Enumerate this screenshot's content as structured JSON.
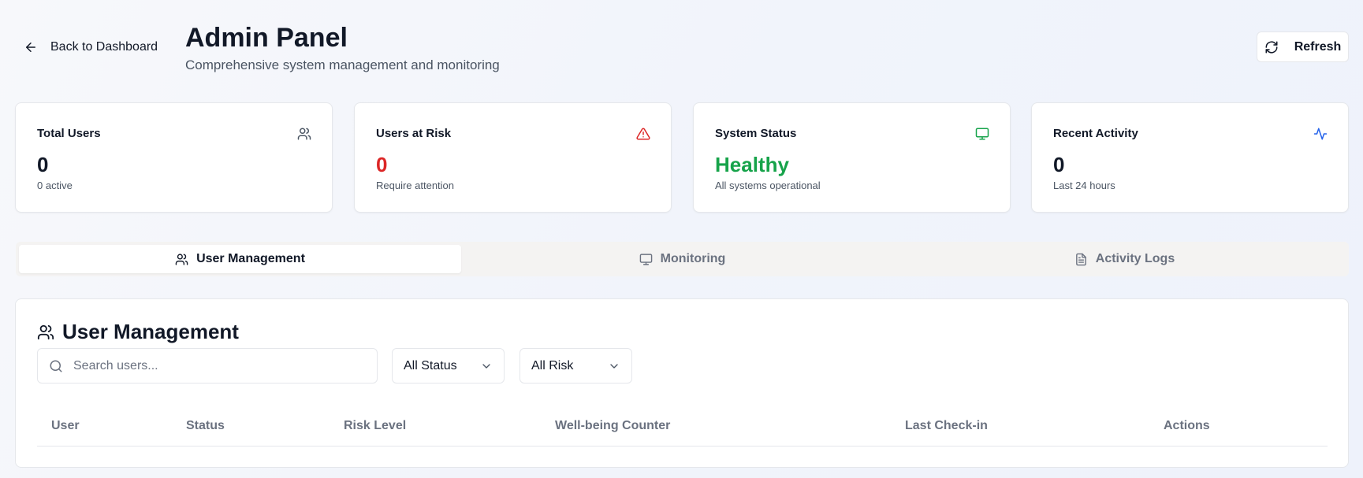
{
  "header": {
    "back_label": "Back to Dashboard",
    "title": "Admin Panel",
    "subtitle": "Comprehensive system management and monitoring",
    "refresh_label": "Refresh"
  },
  "stats": [
    {
      "label": "Total Users",
      "value": "0",
      "sub": "0 active",
      "icon": "users-icon",
      "value_color": "#111827",
      "icon_color": "#4b5563"
    },
    {
      "label": "Users at Risk",
      "value": "0",
      "sub": "Require attention",
      "icon": "alert-triangle-icon",
      "value_color": "#dc2626",
      "icon_color": "#dc2626"
    },
    {
      "label": "System Status",
      "value": "Healthy",
      "sub": "All systems operational",
      "icon": "monitor-icon",
      "value_color": "#16a34a",
      "icon_color": "#16a34a"
    },
    {
      "label": "Recent Activity",
      "value": "0",
      "sub": "Last 24 hours",
      "icon": "activity-icon",
      "value_color": "#111827",
      "icon_color": "#2563eb"
    }
  ],
  "tabs": [
    {
      "label": "User Management",
      "icon": "users-icon",
      "active": true
    },
    {
      "label": "Monitoring",
      "icon": "monitor-icon",
      "active": false
    },
    {
      "label": "Activity Logs",
      "icon": "file-text-icon",
      "active": false
    }
  ],
  "panel": {
    "title": "User Management",
    "search_placeholder": "Search users...",
    "status_filter": "All Status",
    "risk_filter": "All Risk",
    "columns": [
      "User",
      "Status",
      "Risk Level",
      "Well-being Counter",
      "Last Check-in",
      "Actions"
    ]
  }
}
